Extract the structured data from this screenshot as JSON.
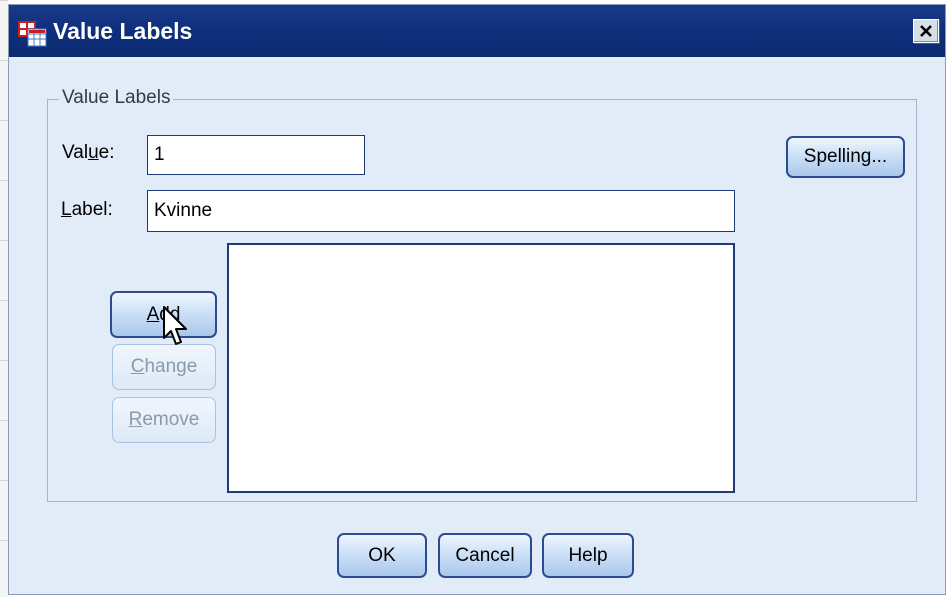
{
  "window": {
    "title": "Value Labels",
    "icon": "spss-table-icon",
    "close_icon": "close-x-icon"
  },
  "group": {
    "legend": "Value Labels"
  },
  "value_field": {
    "label": "Value:",
    "mnemonic": "u",
    "value": "1"
  },
  "label_field": {
    "label": "Label:",
    "mnemonic": "L",
    "value": "Kvinne"
  },
  "buttons": {
    "spelling": "Spelling...",
    "add": "Add",
    "change": "Change",
    "remove": "Remove",
    "ok": "OK",
    "cancel": "Cancel",
    "help": "Help"
  },
  "labels_list": {
    "items": []
  },
  "colors": {
    "title_bar": "#0e2f7c",
    "dialog_bg": "#e2ecf8",
    "button_border": "#2b4c92"
  }
}
